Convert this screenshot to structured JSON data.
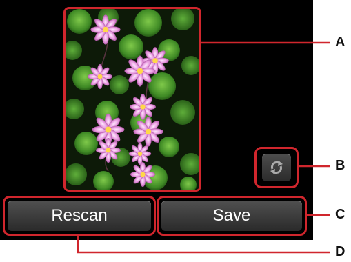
{
  "preview": {
    "image_subject": "pink water lilies among green lily pads"
  },
  "buttons": {
    "rescan_label": "Rescan",
    "save_label": "Save",
    "rotate_icon": "rotate-icon"
  },
  "callouts": {
    "a": "A",
    "b": "B",
    "c": "C",
    "d": "D"
  },
  "colors": {
    "callout_red": "#d0262d",
    "screen_bg": "#000000",
    "button_gray": "#3c3c3c"
  }
}
